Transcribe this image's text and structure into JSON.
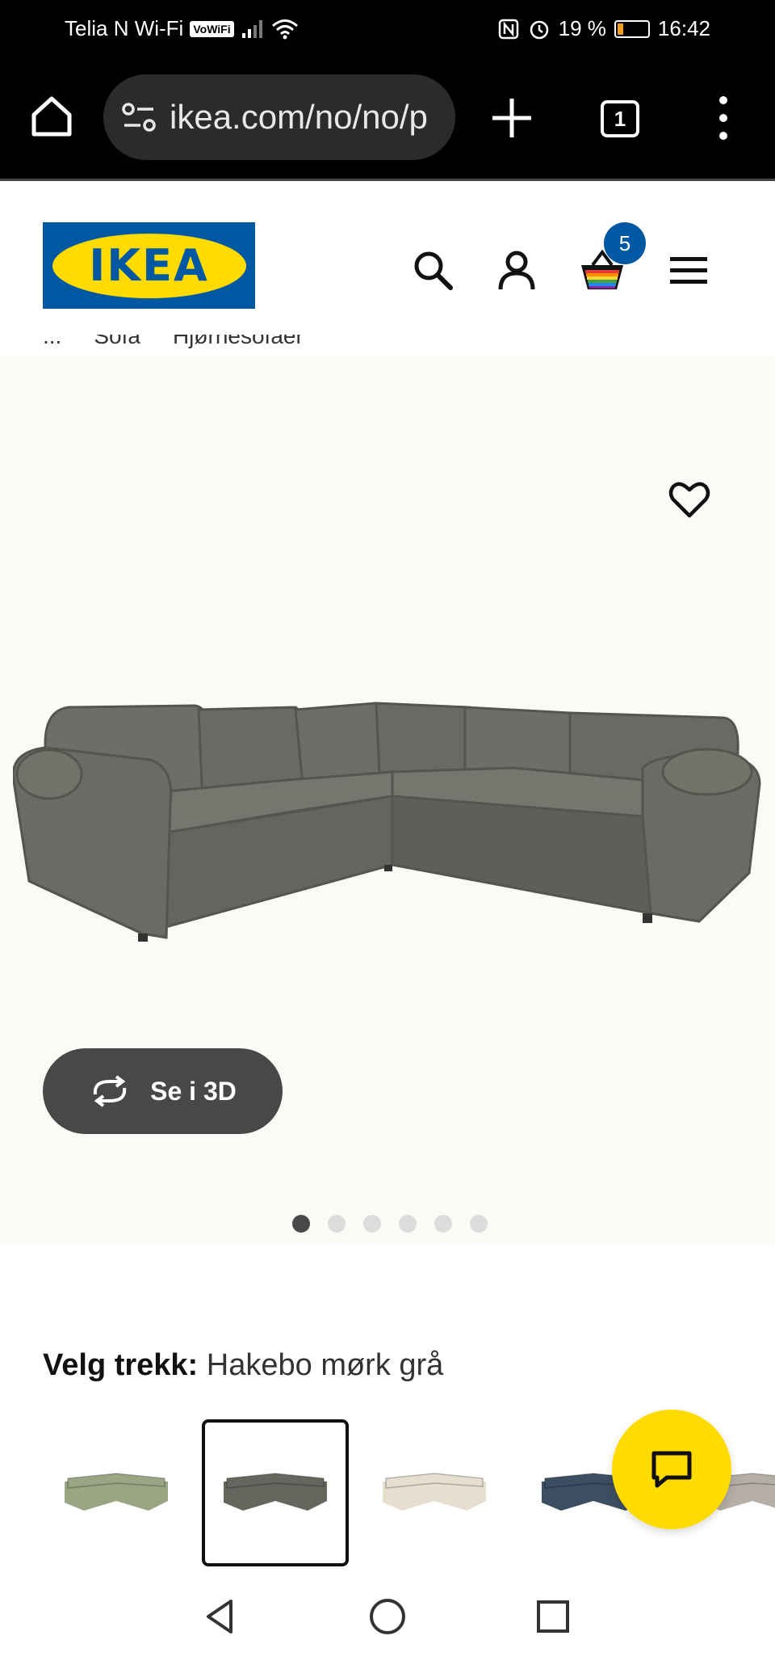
{
  "status_bar": {
    "carrier": "Telia N Wi-Fi",
    "vowifi": "VoWiFi",
    "battery": "19 %",
    "battery_level": 0.19,
    "time": "16:42"
  },
  "browser": {
    "url": "ikea.com/no/no/p",
    "tab_count": "1"
  },
  "header": {
    "logo_text": "IKEA",
    "cart_count": "5"
  },
  "breadcrumb": [
    "...",
    "Sofa",
    "Hjørnesofaer"
  ],
  "product": {
    "view_3d_label": "Se i 3D",
    "image_count": 6,
    "active_image": 0
  },
  "cover": {
    "label": "Velg trekk:",
    "value": "Hakebo mørk grå"
  },
  "swatches": [
    {
      "name": "green",
      "color": "#9aa584"
    },
    {
      "name": "dark-grey",
      "color": "#66665f"
    },
    {
      "name": "beige",
      "color": "#e6dfcf"
    },
    {
      "name": "blue",
      "color": "#3c4e62"
    },
    {
      "name": "light-grey",
      "color": "#b5aea6"
    }
  ],
  "colors": {
    "ikea_blue": "#0058a3",
    "ikea_yellow": "#ffdb00",
    "sofa": "#6a6a64"
  }
}
